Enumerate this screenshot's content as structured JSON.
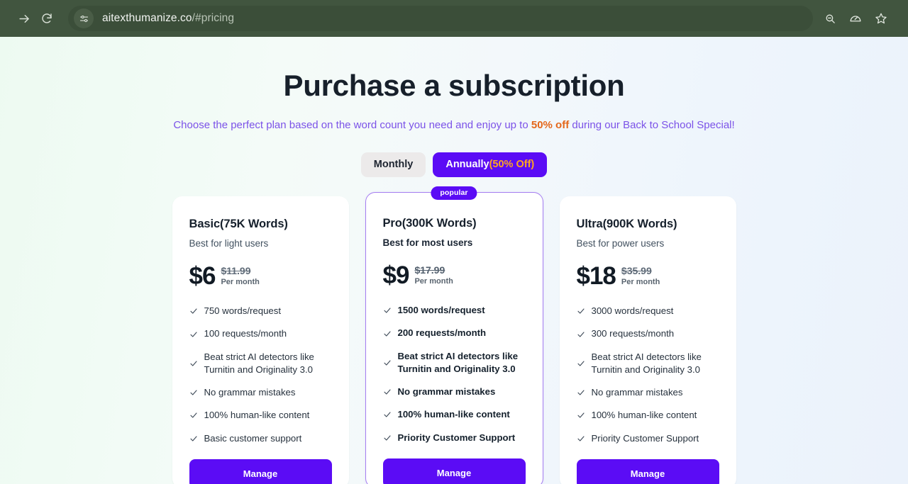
{
  "browser": {
    "forward_icon": "forward-arrow-icon",
    "reload_icon": "reload-icon",
    "site_settings_icon": "site-settings-icon",
    "url_host": "aitexthumanize.co",
    "url_path": "/#pricing",
    "actions": [
      {
        "name": "zoom-out-icon",
        "glyph": "search-minus"
      },
      {
        "name": "performance-icon",
        "glyph": "speedometer"
      },
      {
        "name": "bookmark-icon",
        "glyph": "star"
      }
    ]
  },
  "hero": {
    "title": "Purchase a subscription",
    "subtitle_before": "Choose the perfect plan based on the word count you need and enjoy up to ",
    "subtitle_accent": "50% off",
    "subtitle_after": " during our Back to School Special!",
    "accent_color": "#e4671a",
    "subtitle_color": "#7b52e8"
  },
  "billing_toggle": {
    "monthly_label": "Monthly",
    "annually_label": "Annually",
    "annually_discount": "(50% Off)",
    "active": "annually",
    "active_color": "#5B0CF5",
    "discount_color": "#ffa61f"
  },
  "plans": [
    {
      "name": "Basic(75K Words)",
      "description": "Best for light users",
      "price": "$6",
      "old_price": "$11.99",
      "period": "Per month",
      "badge": null,
      "featured": false,
      "features": [
        "750 words/request",
        "100 requests/month",
        "Beat strict AI detectors like Turnitin and Originality 3.0",
        "No grammar mistakes",
        "100% human-like content",
        "Basic customer support"
      ],
      "cta": "Manage"
    },
    {
      "name": "Pro(300K Words)",
      "description": "Best for most users",
      "price": "$9",
      "old_price": "$17.99",
      "period": "Per month",
      "badge": "popular",
      "featured": true,
      "features": [
        "1500 words/request",
        "200 requests/month",
        "Beat strict AI detectors like Turnitin and Originality 3.0",
        "No grammar mistakes",
        "100% human-like content",
        "Priority Customer Support"
      ],
      "cta": "Manage"
    },
    {
      "name": "Ultra(900K Words)",
      "description": "Best for power users",
      "price": "$18",
      "old_price": "$35.99",
      "period": "Per month",
      "badge": null,
      "featured": false,
      "features": [
        "3000 words/request",
        "300 requests/month",
        "Beat strict AI detectors like Turnitin and Originality 3.0",
        "No grammar mistakes",
        "100% human-like content",
        "Priority Customer Support"
      ],
      "cta": "Manage"
    }
  ]
}
